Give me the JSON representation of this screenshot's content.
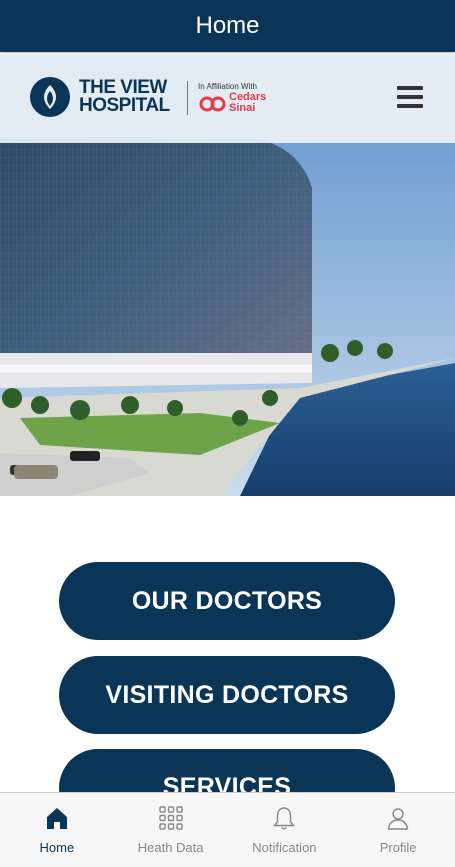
{
  "header": {
    "title": "Home"
  },
  "hero": {
    "logo_text_line1": "THE VIEW",
    "logo_text_line2": "HOSPITAL",
    "affiliation": "In Affiliation With",
    "partner_line1": "Cedars",
    "partner_line2": "Sinai"
  },
  "buttons": {
    "our_doctors": "OUR DOCTORS",
    "visiting_doctors": "VISITING DOCTORS",
    "services": "SERVICES"
  },
  "tabbar": {
    "items": [
      {
        "label": "Home",
        "icon": "home-icon",
        "active": true
      },
      {
        "label": "Heath Data",
        "icon": "grid-icon",
        "active": false
      },
      {
        "label": "Notification",
        "icon": "bell-icon",
        "active": false
      },
      {
        "label": "Profile",
        "icon": "user-icon",
        "active": false
      }
    ]
  },
  "colors": {
    "primary": "#0b3557",
    "partner_red": "#e23a4b",
    "tab_inactive": "#888888"
  }
}
